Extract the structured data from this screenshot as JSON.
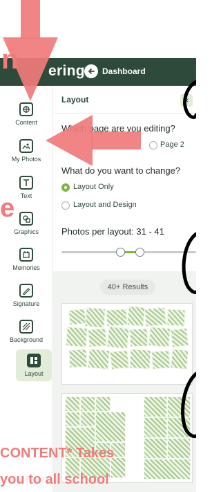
{
  "app": {
    "name": "ering",
    "dashboard_label": "Dashboard"
  },
  "sidebar": {
    "items": [
      {
        "label": "Content",
        "icon": "content-icon"
      },
      {
        "label": "My Photos",
        "icon": "photo-icon"
      },
      {
        "label": "Text",
        "icon": "text-icon"
      },
      {
        "label": "Graphics",
        "icon": "graphics-icon"
      },
      {
        "label": "Memories",
        "icon": "memories-icon"
      },
      {
        "label": "Signature",
        "icon": "signature-icon"
      },
      {
        "label": "Background",
        "icon": "background-icon"
      },
      {
        "label": "Layout",
        "icon": "layout-icon",
        "active": true
      }
    ]
  },
  "panel": {
    "title": "Layout",
    "close_label": "×",
    "question_editing": "Which page are you editing?",
    "page2_label": "Page 2",
    "question_change": "What do you want to change?",
    "options": [
      {
        "label": "Layout Only",
        "selected": true
      },
      {
        "label": "Layout and Design",
        "selected": false
      }
    ],
    "photos_per_layout": "Photos per layout: 31 - 41",
    "results_label": "40+ Results"
  },
  "overlay": {
    "line1": "CONTENT* Takes",
    "line2": "you to all school",
    "left_letter_1": "n",
    "left_letter_2": "e"
  },
  "colors": {
    "brand": "#2e4a3a",
    "accent": "#7bb83a",
    "annotation": "#f07b7b"
  }
}
